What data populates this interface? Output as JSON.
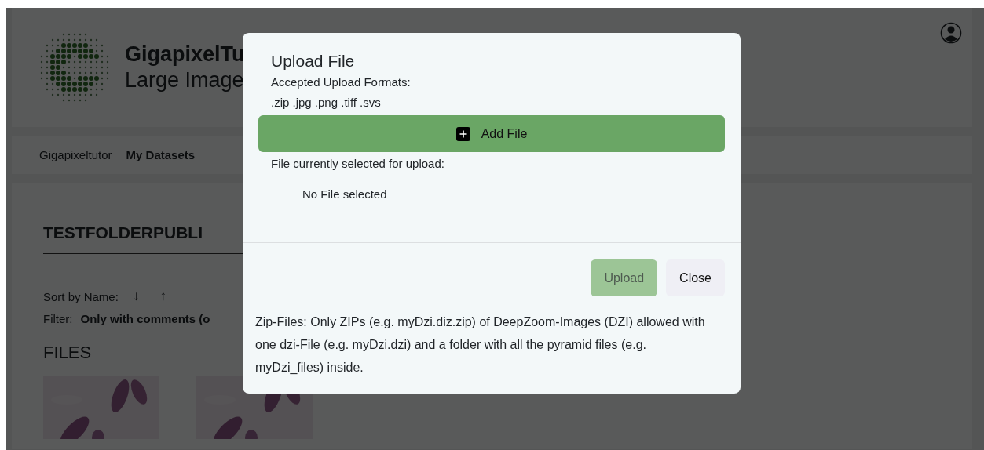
{
  "header": {
    "title": "GigapixelTu",
    "subtitle": "Large Image"
  },
  "nav": [
    {
      "label": "Gigapixeltutor",
      "selected": false
    },
    {
      "label": "My Datasets",
      "selected": true
    }
  ],
  "folder": {
    "title": "TESTFOLDERPUBLI",
    "sort_label": "Sort by Name:",
    "sort_buttons": [
      "↓",
      "↑"
    ],
    "filter_label": "Filter:",
    "filter_value": "Only with comments (o",
    "files_heading": "FILES"
  },
  "modal": {
    "title": "Upload File",
    "formats_label": "Accepted Upload Formats:",
    "formats": ".zip .jpg .png .tiff .svs",
    "add_button": "Add File",
    "selected_label": "File currently selected for upload:",
    "selected_file": "No File selected",
    "buttons": [
      {
        "label": "Upload",
        "kind": "primary",
        "disabled": true
      },
      {
        "label": "Close",
        "kind": "secondary",
        "disabled": false
      }
    ],
    "note": "Zip-Files: Only ZIPs (e.g. myDzi.diz.zip) of DeepZoom-Images (DZI) allowed with one dzi-File (e.g. myDzi.dzi) and a folder with all the pyramid files (e.g. myDzi_files) inside."
  }
}
